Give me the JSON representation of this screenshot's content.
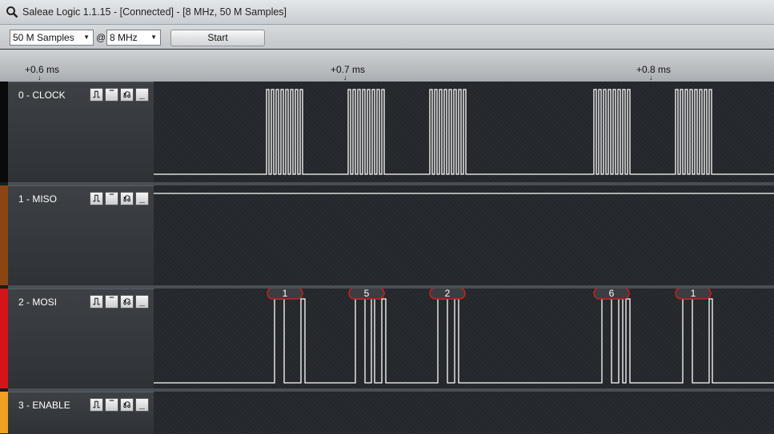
{
  "window": {
    "title": "Saleae Logic 1.1.15 - [Connected] - [8 MHz, 50 M Samples]"
  },
  "toolbar": {
    "samples_value": "50 M Samples",
    "at_label": "@",
    "rate_value": "8 MHz",
    "start_label": "Start"
  },
  "ruler": {
    "ticks": [
      "+0.6 ms",
      "+0.7 ms",
      "+0.8 ms"
    ]
  },
  "trigger_buttons": [
    "rising-edge",
    "high",
    "falling-edge",
    "low"
  ],
  "channels": [
    {
      "name": "0 - CLOCK",
      "color": "#0a0a0a"
    },
    {
      "name": "1 - MISO",
      "color": "#8b4513"
    },
    {
      "name": "2 - MOSI",
      "color": "#d4141a"
    },
    {
      "name": "3 - ENABLE",
      "color": "#f0a020"
    }
  ],
  "mosi_bytes": [
    "1",
    "5",
    "2",
    "6",
    "1"
  ],
  "colors": {
    "trace": "#ffffff",
    "badge_border": "#cc1f1f",
    "badge_fill": "#3a3d41"
  }
}
